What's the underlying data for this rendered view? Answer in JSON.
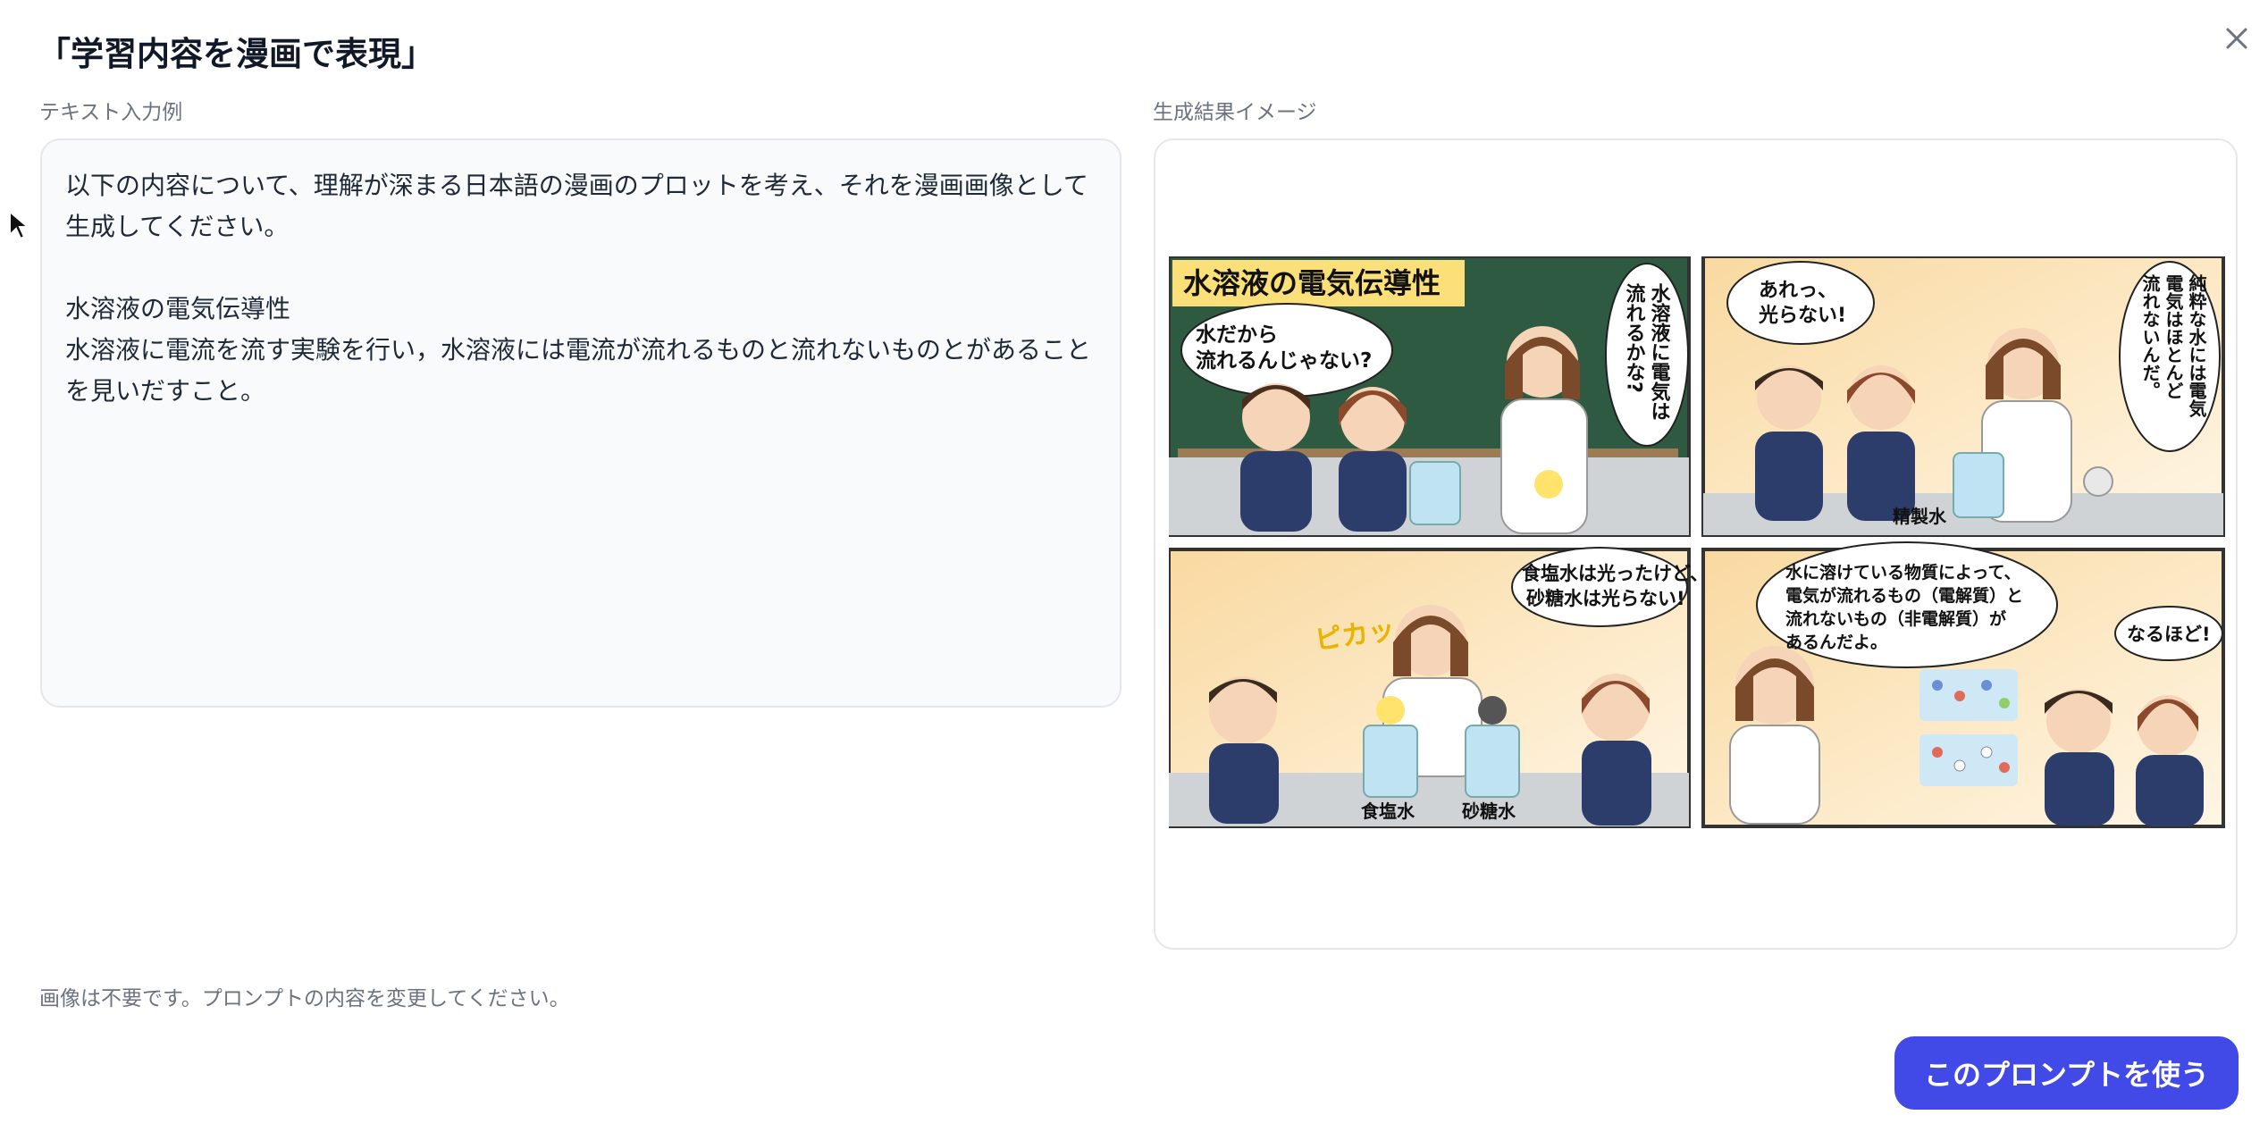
{
  "dialog": {
    "title": "「学習内容を漫画で表現」",
    "close_icon": "close-icon"
  },
  "input_example": {
    "label": "テキスト入力例",
    "line1": "以下の内容について、理解が深まる日本語の漫画のプロットを考え、それを漫画画像として",
    "line2": "生成してください。",
    "topic": "水溶液の電気伝導性",
    "line3": "水溶液に電流を流す実験を行い，水溶液には電流が流れるものと流れないものとがあること",
    "line4": "を見いだすこと。"
  },
  "result": {
    "label": "生成結果イメージ",
    "comic": {
      "panel1_title": "水溶液の電気伝導性",
      "panel1_bubble_left_1": "水だから",
      "panel1_bubble_left_2": "流れるんじゃない?",
      "panel1_bubble_right_col1": "水溶液に電気は",
      "panel1_bubble_right_col2": "流れるかな?",
      "panel2_bubble_left_1": "あれっ、",
      "panel2_bubble_left_2": "光らない!",
      "panel2_bubble_right_col1": "純粋な水には電気",
      "panel2_bubble_right_col2": "電気はほとんど",
      "panel2_bubble_right_col3": "流れないんだ。",
      "panel2_caption": "精製水",
      "panel3_bubble_1": "食塩水は光ったけど、",
      "panel3_bubble_2": "砂糖水は光らない!",
      "panel3_sfx": "ピカッ",
      "panel3_caption_left": "食塩水",
      "panel3_caption_right": "砂糖水",
      "panel4_bubble_1": "水に溶けている物質によって、",
      "panel4_bubble_2": "電気が流れるもの（電解質）と",
      "panel4_bubble_3": "流れないもの（非電解質）が",
      "panel4_bubble_4": "あるんだよ。",
      "panel4_bubble_small": "なるほど!"
    }
  },
  "footer": {
    "note": "画像は不要です。プロンプトの内容を変更してください。",
    "use_button": "このプロンプトを使う"
  },
  "colors": {
    "accent": "#4149e6",
    "panel_bg": "#f8fafc",
    "border": "#e5e7eb",
    "muted_text": "#6b7280"
  }
}
